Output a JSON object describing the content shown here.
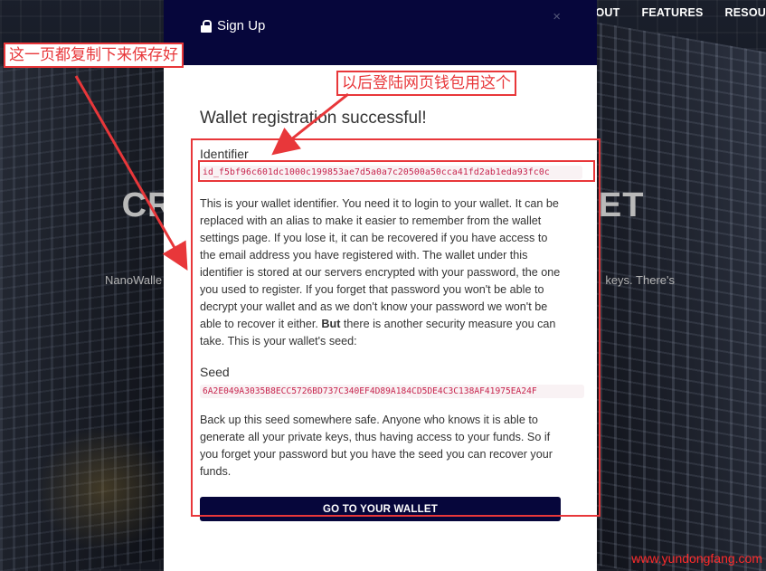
{
  "nav": {
    "items": [
      {
        "label": "ABOUT"
      },
      {
        "label": "FEATURES"
      },
      {
        "label": "RESOU"
      }
    ]
  },
  "hero": {
    "title": "CREA ALLET",
    "subtitle_left": "NanoWalle",
    "subtitle_right": "keys. There's"
  },
  "modal": {
    "title": "Sign Up",
    "close_glyph": "×",
    "heading": "Wallet registration successful!",
    "identifier_label": "Identifier",
    "identifier_value": "id_f5bf96c601dc1000c199853ae7d5a0a7c20500a50cca41fd2ab1eda93fc0c",
    "identifier_paragraph_pre": "This is your wallet identifier. You need it to login to your wallet. It can be replaced with an alias to make it easier to remember from the wallet settings page. If you lose it, it can be recovered if you have access to the email address you have registered with. The wallet under this identifier is stored at our servers encrypted with your password, the one you used to register. If you forget that password you won't be able to decrypt your wallet and as we don't know your password we won't be able to recover it either. ",
    "identifier_paragraph_bold": "But",
    "identifier_paragraph_post": " there is another security measure you can take. This is your wallet's seed:",
    "seed_label": "Seed",
    "seed_value": "6A2E049A3035B8ECC5726BD737C340EF4D89A184CD5DE4C3C138AF41975EA24F",
    "seed_paragraph": "Back up this seed somewhere safe. Anyone who knows it is able to generate all your private keys, thus having access to your funds. So if you forget your password but you have the seed you can recover your funds.",
    "button_label": "GO TO YOUR WALLET"
  },
  "annotations": {
    "copy_note": "这一页都复制下来保存好",
    "login_note": "以后登陆网页钱包用这个"
  },
  "watermark": "www.yundongfang.com",
  "colors": {
    "modal_header": "#06063b",
    "annotation_red": "#e8373a",
    "code_text": "#c7254e"
  }
}
